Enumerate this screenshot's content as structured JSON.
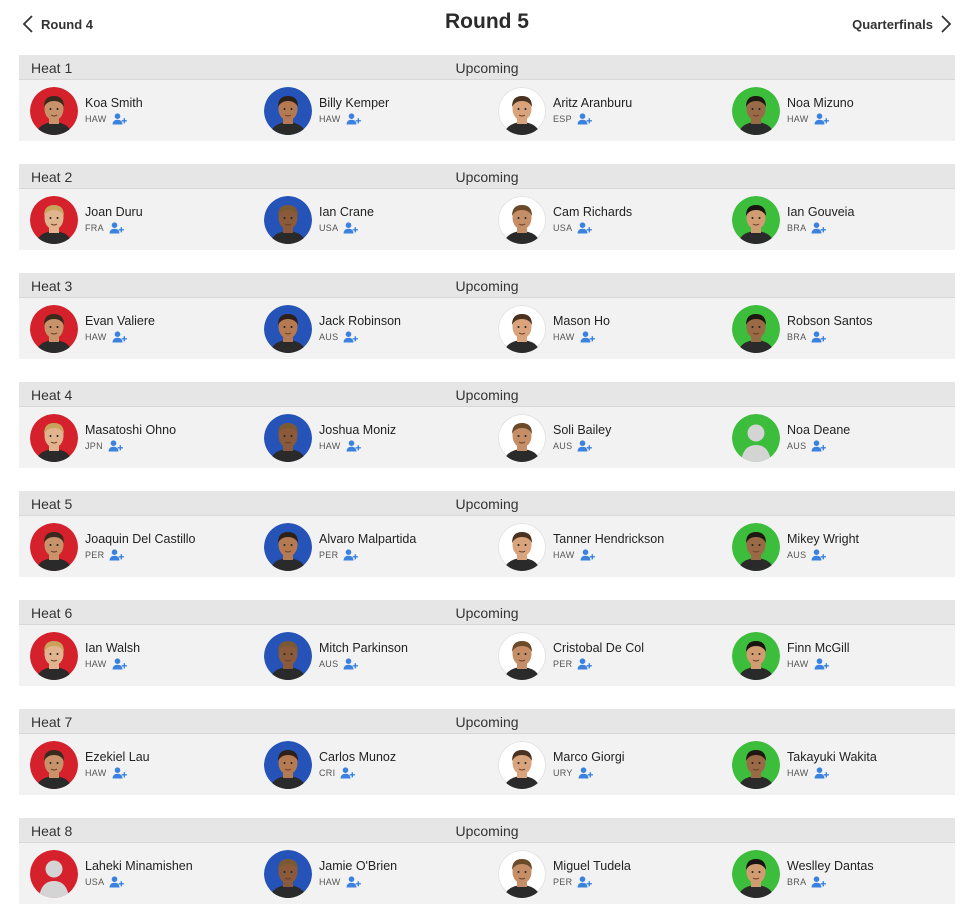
{
  "nav": {
    "prev_label": "Round 4",
    "next_label": "Quarterfinals",
    "title": "Round 5"
  },
  "colors": {
    "red": "#d5212b",
    "blue": "#2553b8",
    "white": "#ffffff",
    "green": "#3cbd3c",
    "follow": "#3b82e0",
    "placeholder": "#d4d4d4"
  },
  "icons": {
    "prev": "chevron-left-icon",
    "next": "chevron-right-icon",
    "follow": "add-user-icon"
  },
  "heats": [
    {
      "label": "Heat 1",
      "status": "Upcoming",
      "athletes": [
        {
          "name": "Koa Smith",
          "country": "HAW",
          "color": "red",
          "photo": true
        },
        {
          "name": "Billy Kemper",
          "country": "HAW",
          "color": "blue",
          "photo": true
        },
        {
          "name": "Aritz Aranburu",
          "country": "ESP",
          "color": "white",
          "photo": true
        },
        {
          "name": "Noa Mizuno",
          "country": "HAW",
          "color": "green",
          "photo": true
        }
      ]
    },
    {
      "label": "Heat 2",
      "status": "Upcoming",
      "athletes": [
        {
          "name": "Joan Duru",
          "country": "FRA",
          "color": "red",
          "photo": true
        },
        {
          "name": "Ian Crane",
          "country": "USA",
          "color": "blue",
          "photo": true
        },
        {
          "name": "Cam Richards",
          "country": "USA",
          "color": "white",
          "photo": true
        },
        {
          "name": "Ian Gouveia",
          "country": "BRA",
          "color": "green",
          "photo": true
        }
      ]
    },
    {
      "label": "Heat 3",
      "status": "Upcoming",
      "athletes": [
        {
          "name": "Evan Valiere",
          "country": "HAW",
          "color": "red",
          "photo": true
        },
        {
          "name": "Jack Robinson",
          "country": "AUS",
          "color": "blue",
          "photo": true
        },
        {
          "name": "Mason Ho",
          "country": "HAW",
          "color": "white",
          "photo": true
        },
        {
          "name": "Robson Santos",
          "country": "BRA",
          "color": "green",
          "photo": true
        }
      ]
    },
    {
      "label": "Heat 4",
      "status": "Upcoming",
      "athletes": [
        {
          "name": "Masatoshi Ohno",
          "country": "JPN",
          "color": "red",
          "photo": true
        },
        {
          "name": "Joshua Moniz",
          "country": "HAW",
          "color": "blue",
          "photo": true
        },
        {
          "name": "Soli Bailey",
          "country": "AUS",
          "color": "white",
          "photo": true
        },
        {
          "name": "Noa Deane",
          "country": "AUS",
          "color": "green",
          "photo": false
        }
      ]
    },
    {
      "label": "Heat 5",
      "status": "Upcoming",
      "athletes": [
        {
          "name": "Joaquin Del Castillo",
          "country": "PER",
          "color": "red",
          "photo": true
        },
        {
          "name": "Alvaro Malpartida",
          "country": "PER",
          "color": "blue",
          "photo": true
        },
        {
          "name": "Tanner Hendrickson",
          "country": "HAW",
          "color": "white",
          "photo": true
        },
        {
          "name": "Mikey Wright",
          "country": "AUS",
          "color": "green",
          "photo": true
        }
      ]
    },
    {
      "label": "Heat 6",
      "status": "Upcoming",
      "athletes": [
        {
          "name": "Ian Walsh",
          "country": "HAW",
          "color": "red",
          "photo": true
        },
        {
          "name": "Mitch Parkinson",
          "country": "AUS",
          "color": "blue",
          "photo": true
        },
        {
          "name": "Cristobal De Col",
          "country": "PER",
          "color": "white",
          "photo": true
        },
        {
          "name": "Finn McGill",
          "country": "HAW",
          "color": "green",
          "photo": true
        }
      ]
    },
    {
      "label": "Heat 7",
      "status": "Upcoming",
      "athletes": [
        {
          "name": "Ezekiel Lau",
          "country": "HAW",
          "color": "red",
          "photo": true
        },
        {
          "name": "Carlos Munoz",
          "country": "CRI",
          "color": "blue",
          "photo": true
        },
        {
          "name": "Marco Giorgi",
          "country": "URY",
          "color": "white",
          "photo": true
        },
        {
          "name": "Takayuki Wakita",
          "country": "HAW",
          "color": "green",
          "photo": true
        }
      ]
    },
    {
      "label": "Heat 8",
      "status": "Upcoming",
      "athletes": [
        {
          "name": "Laheki Minamishen",
          "country": "USA",
          "color": "red",
          "photo": false
        },
        {
          "name": "Jamie O'Brien",
          "country": "HAW",
          "color": "blue",
          "photo": true
        },
        {
          "name": "Miguel Tudela",
          "country": "PER",
          "color": "white",
          "photo": true
        },
        {
          "name": "Weslley Dantas",
          "country": "BRA",
          "color": "green",
          "photo": true
        }
      ]
    }
  ]
}
